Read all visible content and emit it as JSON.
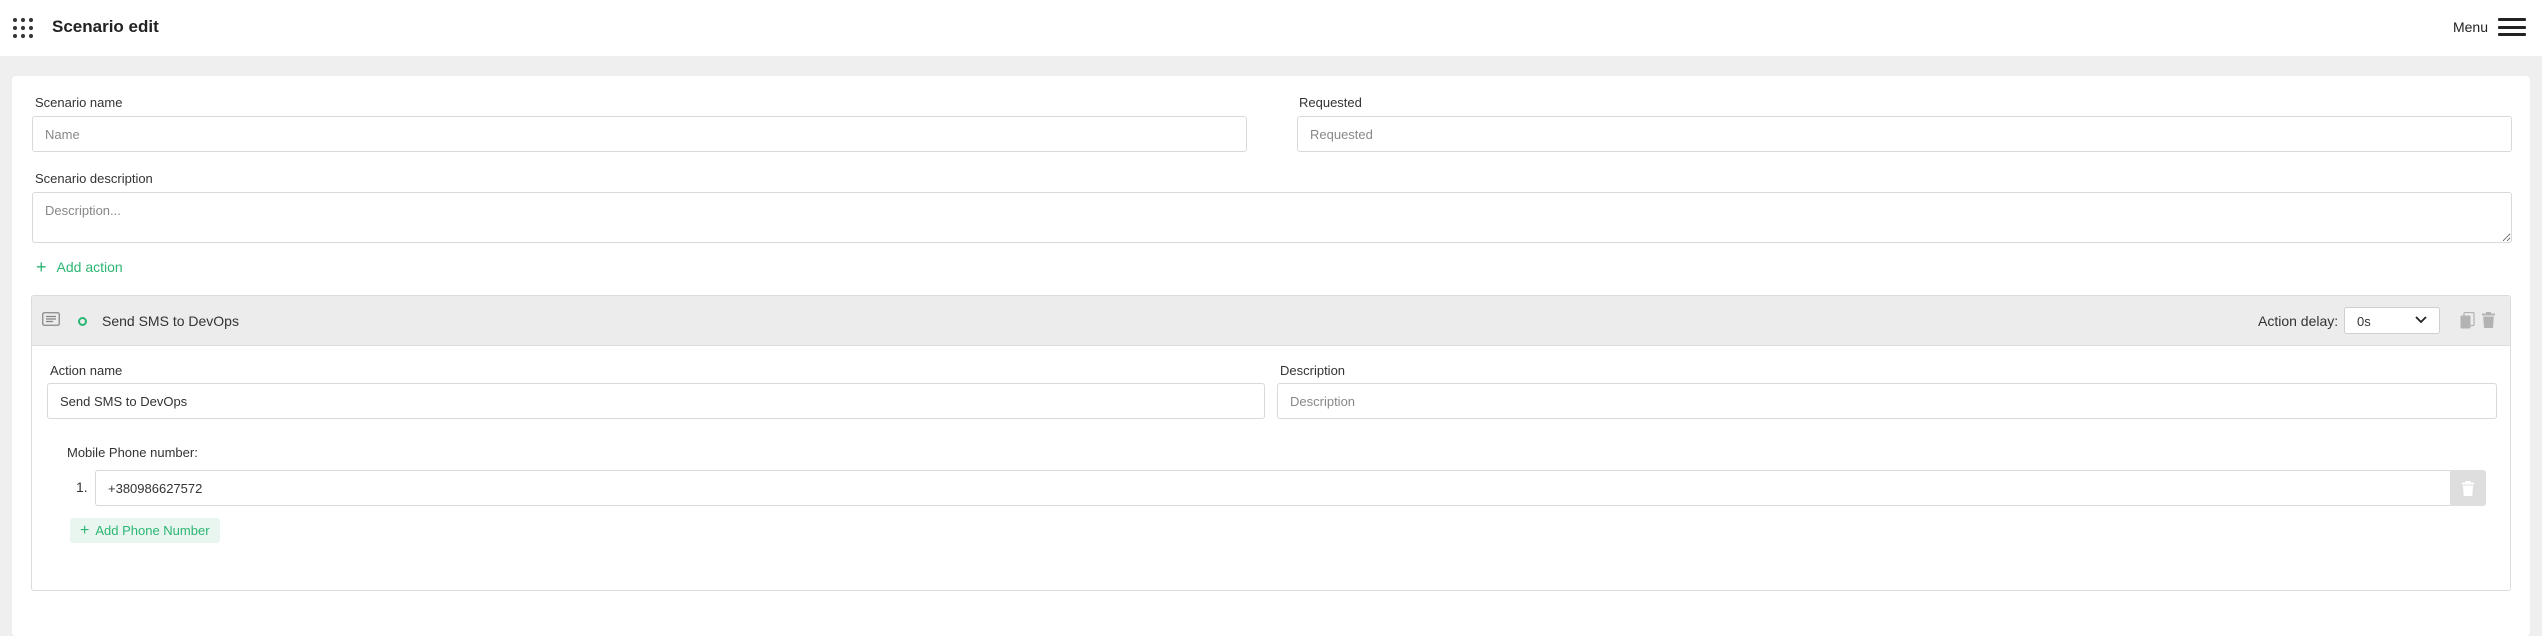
{
  "header": {
    "title": "Scenario edit",
    "menu_label": "Menu",
    "apps_icon": "apps-grid-icon",
    "menu_icon": "hamburger-icon"
  },
  "form": {
    "scenario_name": {
      "label": "Scenario name",
      "value": "",
      "placeholder": "Name"
    },
    "requested": {
      "label": "Requested",
      "value": "",
      "placeholder": "Requested"
    },
    "scenario_description": {
      "label": "Scenario description",
      "value": "",
      "placeholder": "Description..."
    },
    "add_action_label": "Add action"
  },
  "action": {
    "title": "Send SMS to DevOps",
    "type_icon": "message-icon",
    "status_color": "#2bb673",
    "delay_label": "Action delay:",
    "delay_value": "0s",
    "action_name": {
      "label": "Action name",
      "value": "Send SMS to DevOps",
      "placeholder": ""
    },
    "description": {
      "label": "Description",
      "value": "",
      "placeholder": "Description"
    },
    "phones_label": "Mobile Phone number:",
    "phones": [
      {
        "index": "1.",
        "value": "+380986627572"
      }
    ],
    "add_phone_label": "Add Phone Number"
  },
  "colors": {
    "accent": "#2bb673",
    "page_bg": "#efefef",
    "header_bg": "#ececec"
  }
}
